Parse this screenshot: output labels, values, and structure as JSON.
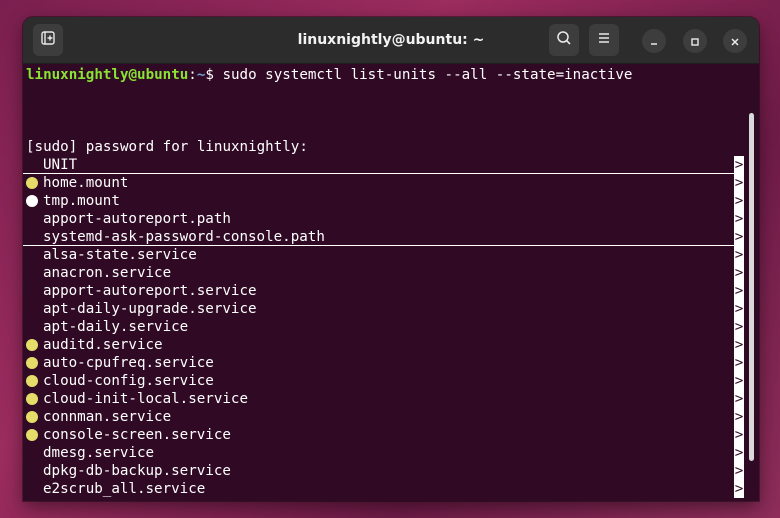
{
  "window": {
    "title": "linuxnightly@ubuntu: ~"
  },
  "icons": {
    "new_tab": "new-tab-icon",
    "search": "search-icon",
    "menu": "hamburger-menu-icon",
    "minimize": "minimize-icon",
    "maximize": "maximize-icon",
    "close": "close-icon"
  },
  "prompt": {
    "user_host": "linuxnightly@ubuntu",
    "colon": ":",
    "path": "~",
    "symbol": "$",
    "command": " sudo systemctl list-units --all --state=inactive"
  },
  "sudo_prompt": "[sudo] password for linuxnightly:",
  "header": {
    "label": "UNIT",
    "arrow": ">"
  },
  "units": [
    {
      "name": "home.mount",
      "dot": "#e5dc6a",
      "arrow": ">"
    },
    {
      "name": "tmp.mount",
      "dot": "#ffffff",
      "arrow": ">"
    },
    {
      "name": "apport-autoreport.path",
      "dot": "",
      "arrow": ">"
    },
    {
      "name": "systemd-ask-password-console.path",
      "dot": "",
      "arrow": ">"
    },
    {
      "name": "alsa-state.service",
      "dot": "",
      "arrow": ">"
    },
    {
      "name": "anacron.service",
      "dot": "",
      "arrow": ">"
    },
    {
      "name": "apport-autoreport.service",
      "dot": "",
      "arrow": ">"
    },
    {
      "name": "apt-daily-upgrade.service",
      "dot": "",
      "arrow": ">"
    },
    {
      "name": "apt-daily.service",
      "dot": "",
      "arrow": ">"
    },
    {
      "name": "auditd.service",
      "dot": "#e5dc6a",
      "arrow": ">"
    },
    {
      "name": "auto-cpufreq.service",
      "dot": "#e5dc6a",
      "arrow": ">"
    },
    {
      "name": "cloud-config.service",
      "dot": "#e5dc6a",
      "arrow": ">"
    },
    {
      "name": "cloud-init-local.service",
      "dot": "#e5dc6a",
      "arrow": ">"
    },
    {
      "name": "connman.service",
      "dot": "#e5dc6a",
      "arrow": ">"
    },
    {
      "name": "console-screen.service",
      "dot": "#e5dc6a",
      "arrow": ">"
    },
    {
      "name": "dmesg.service",
      "dot": "",
      "arrow": ">"
    },
    {
      "name": "dpkg-db-backup.service",
      "dot": "",
      "arrow": ">"
    },
    {
      "name": "e2scrub_all.service",
      "dot": "",
      "arrow": ">"
    }
  ]
}
